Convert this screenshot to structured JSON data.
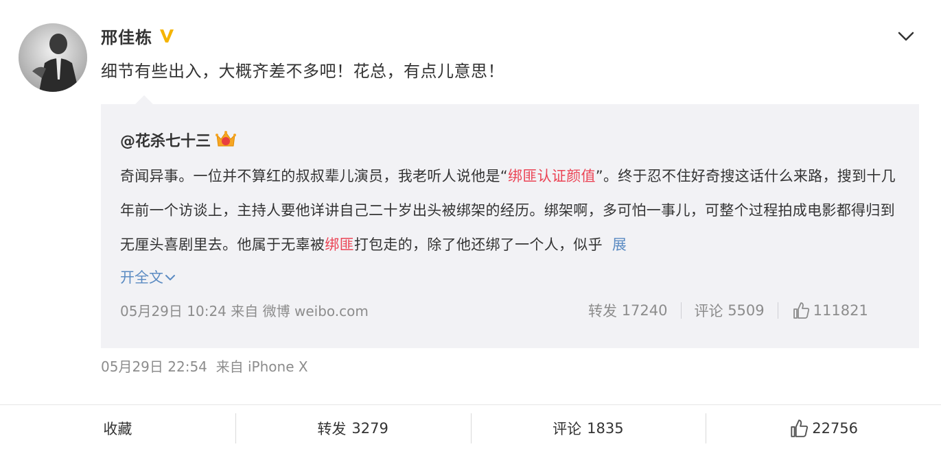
{
  "author": {
    "name": "邢佳栋",
    "avatar_icon": "avatar-photo",
    "verified_icon": "verified-v-icon",
    "verified_color": "#f5b400"
  },
  "post": {
    "text": "细节有些出入，大概齐差不多吧！花总，有点儿意思！",
    "time": "05月29日 22:54",
    "source_prefix": "来自",
    "source": "iPhone X"
  },
  "repost": {
    "author": "@花杀七十三",
    "author_badge_icon": "crown-icon",
    "text_part1": "奇闻异事。一位并不算红的叔叔辈儿演员，我老听人说他是“",
    "link1": "绑匪认证颜值",
    "text_part2": "”。终于忍不住好奇搜这话什么来路，搜到十几年前一个访谈上，主持人要他详讲自己二十岁出头被绑架的经历。绑架啊，多可怕一事儿，可整个过程拍成电影都得归到无厘头喜剧里去。他属于无辜被",
    "link2": "绑匪",
    "text_part3": "打包走的，除了他还绑了一个人，似乎",
    "expand_label_1": "展",
    "expand_label_2": "开全文",
    "time": "05月29日 10:24",
    "source_prefix": "来自",
    "source": "微博 weibo.com",
    "repost_label": "转发",
    "repost_count": "17240",
    "comment_label": "评论",
    "comment_count": "5509",
    "like_count": "111821",
    "link_color": "#eb4455",
    "expand_color": "#5b8bc2"
  },
  "actions": {
    "favorite_label": "收藏",
    "repost_label": "转发",
    "repost_count": "3279",
    "comment_label": "评论",
    "comment_count": "1835",
    "like_count": "22756"
  }
}
